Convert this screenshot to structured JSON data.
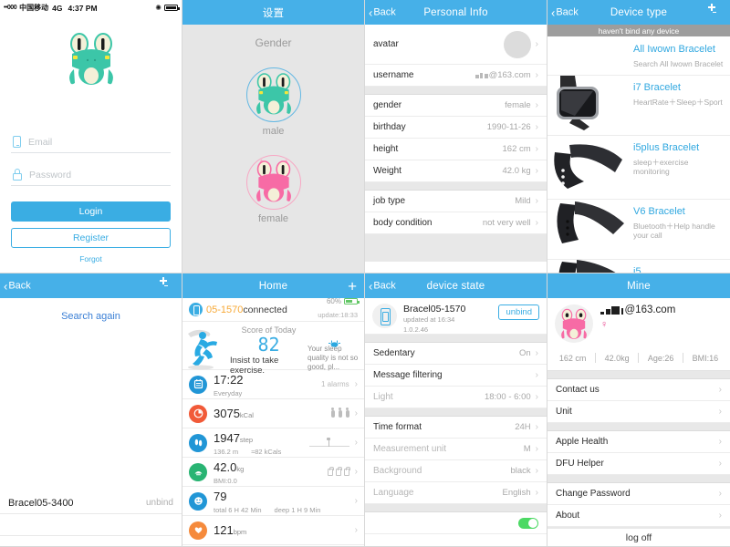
{
  "login": {
    "statusbar": {
      "dots": "••000",
      "carrier": "中国移动",
      "network": "4G",
      "time": "4:37 PM",
      "bluetooth_icon": "bluetooth-icon",
      "battery_icon": "battery-icon"
    },
    "logo_icon": "frog-logo-green",
    "email_placeholder": "Email",
    "email_value": "",
    "password_placeholder": "Password",
    "password_value": "",
    "login_label": "Login",
    "register_label": "Register",
    "forgot_label": "Forgot"
  },
  "gender": {
    "title": "设置",
    "section_label": "Gender",
    "male_label": "male",
    "female_label": "female",
    "male_icon": "frog-avatar-green",
    "female_icon": "frog-avatar-pink",
    "selected": "male"
  },
  "personal_info": {
    "back_label": "Back",
    "title": "Personal Info",
    "rows_group1": [
      {
        "label": "avatar",
        "value": "",
        "type": "avatar"
      },
      {
        "label": "username",
        "value": "@163.com",
        "type": "masked"
      }
    ],
    "rows_group2": [
      {
        "label": "gender",
        "value": "female"
      },
      {
        "label": "birthday",
        "value": "1990-11-26"
      },
      {
        "label": "height",
        "value": "162 cm"
      },
      {
        "label": "Weight",
        "value": "42.0 kg"
      }
    ],
    "rows_group3": [
      {
        "label": "job type",
        "value": "Mild"
      },
      {
        "label": "body condition",
        "value": "not very well"
      }
    ]
  },
  "device_type": {
    "back_label": "Back",
    "title": "Device type",
    "scan_icon": "scan-icon",
    "banner": "haven't bind any device",
    "devices": [
      {
        "name": "All Iwown Bracelet",
        "desc": "Search All Iwown Bracelet",
        "thumb": ""
      },
      {
        "name": "i7 Bracelet",
        "desc": "HeartRate＋Sleep＋Sport",
        "thumb": "watch-square"
      },
      {
        "name": "i5plus Bracelet",
        "desc": "sleep＋exercise monitoring",
        "thumb": "band-curved"
      },
      {
        "name": "V6 Bracelet",
        "desc": "Bluetooth＋Help handle your call",
        "thumb": "band-flat"
      },
      {
        "name": "i5",
        "desc": "",
        "thumb": "band-dark"
      }
    ]
  },
  "search": {
    "back_label": "Back",
    "scan_icon": "scan-icon",
    "search_again_label": "Search again",
    "found_device": "Bracel05-3400",
    "unbind_label": "unbind"
  },
  "home": {
    "title": "Home",
    "add_icon": "plus-icon",
    "connection": {
      "device_icon": "bracelet-icon",
      "device_id": "05-1570",
      "state": "connected",
      "battery_percent": "60%",
      "update_text": "update:18:33"
    },
    "score_card": {
      "runner_icon": "runner-icon",
      "score_label": "Score of Today",
      "score_value": "82",
      "tip": "Insist to take exercise.",
      "crab_icon": "crab-icon",
      "sleep_note": "Your sleep quality is not so good, pl..."
    },
    "rows": [
      {
        "icon": "alarm-clock-icon",
        "icon_color": "#2196d6",
        "value": "17:22",
        "unit": "",
        "sub_left": "Everyday",
        "sub_right": "",
        "right_text": "1 alarms",
        "right_widget": ""
      },
      {
        "icon": "calorie-icon",
        "icon_color": "#f15a38",
        "value": "3075",
        "unit": "kCal",
        "sub_left": "",
        "sub_right": "",
        "right_text": "",
        "right_widget": "people-dots"
      },
      {
        "icon": "footstep-icon",
        "icon_color": "#2196d6",
        "value": "1947",
        "unit": "step",
        "sub_left": "136.2 m",
        "sub_right": "≈82 kCals",
        "right_text": "",
        "right_widget": "sparkline"
      },
      {
        "icon": "scale-icon",
        "icon_color": "#29b473",
        "value": "42.0",
        "unit": "kg",
        "sub_left": "BMI:0.0",
        "sub_right": "",
        "right_text": "",
        "right_widget": "bags"
      },
      {
        "icon": "sleep-icon",
        "icon_color": "#2196d6",
        "value": "79",
        "unit": "",
        "sub_left": "total 6 H 42 Min",
        "sub_right": "deep 1 H 9 Min",
        "right_text": "",
        "right_widget": ""
      },
      {
        "icon": "heart-icon",
        "icon_color": "#f58a3c",
        "value": "121",
        "unit": "bpm",
        "sub_left": "",
        "sub_right": "",
        "right_text": "",
        "right_widget": ""
      }
    ]
  },
  "device_state": {
    "back_label": "Back",
    "title": "device state",
    "device_name": "Bracel05-1570",
    "updated_at": "updated at 16:34",
    "firmware": "1.0.2.46",
    "unbind_label": "unbind",
    "group1": [
      {
        "label": "Sedentary",
        "value": "On",
        "dim": false
      },
      {
        "label": "Message filtering",
        "value": "",
        "dim": false
      },
      {
        "label": "Light",
        "value": "18:00 - 6:00",
        "dim": true
      }
    ],
    "group2": [
      {
        "label": "Time format",
        "value": "24H",
        "dim": false
      },
      {
        "label": "Measurement unit",
        "value": "M",
        "dim": true
      },
      {
        "label": "Background",
        "value": "black",
        "dim": true
      },
      {
        "label": "Language",
        "value": "English",
        "dim": true
      }
    ]
  },
  "mine": {
    "title": "Mine",
    "avatar_icon": "frog-avatar-pink",
    "username": "@163.com",
    "gender_icon": "female-symbol",
    "stats": [
      "162 cm",
      "42.0kg",
      "Age:26",
      "BMI:16"
    ],
    "group1": [
      {
        "label": "Contact us"
      },
      {
        "label": "Unit"
      }
    ],
    "group2": [
      {
        "label": "Apple Health"
      },
      {
        "label": "DFU Helper"
      }
    ],
    "group3": [
      {
        "label": "Change Password"
      },
      {
        "label": "About"
      }
    ],
    "logoff_label": "log off"
  },
  "colors": {
    "nav_blue": "#46b0e8",
    "accent_blue": "#3aade3",
    "orange": "#f7a937",
    "green": "#4cd964",
    "pink": "#f7a8c4"
  }
}
